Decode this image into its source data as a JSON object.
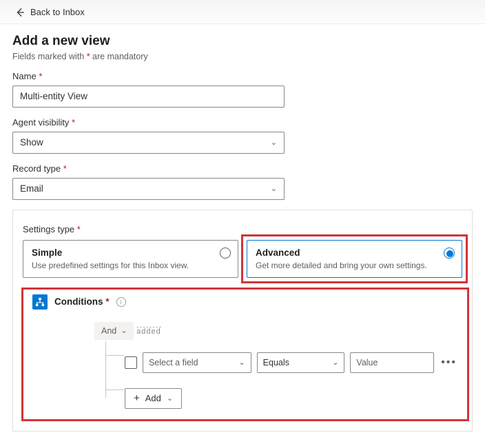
{
  "nav": {
    "back_label": "Back to Inbox"
  },
  "page": {
    "title": "Add a new view",
    "hint_prefix": "Fields marked with ",
    "hint_star": "*",
    "hint_suffix": " are mandatory"
  },
  "fields": {
    "name": {
      "label": "Name",
      "value": "Multi-entity View"
    },
    "agent_visibility": {
      "label": "Agent visibility",
      "value": "Show"
    },
    "record_type": {
      "label": "Record type",
      "value": "Email"
    }
  },
  "settings_type": {
    "label": "Settings type",
    "simple": {
      "title": "Simple",
      "desc": "Use predefined settings for this Inbox view."
    },
    "advanced": {
      "title": "Advanced",
      "desc": "Get more detailed and bring your own settings."
    },
    "selected": "advanced"
  },
  "conditions": {
    "header": "Conditions",
    "group_op": "And",
    "added_caption": "added",
    "row": {
      "field_placeholder": "Select a field",
      "operator": "Equals",
      "value_placeholder": "Value"
    },
    "add_label": "Add"
  }
}
